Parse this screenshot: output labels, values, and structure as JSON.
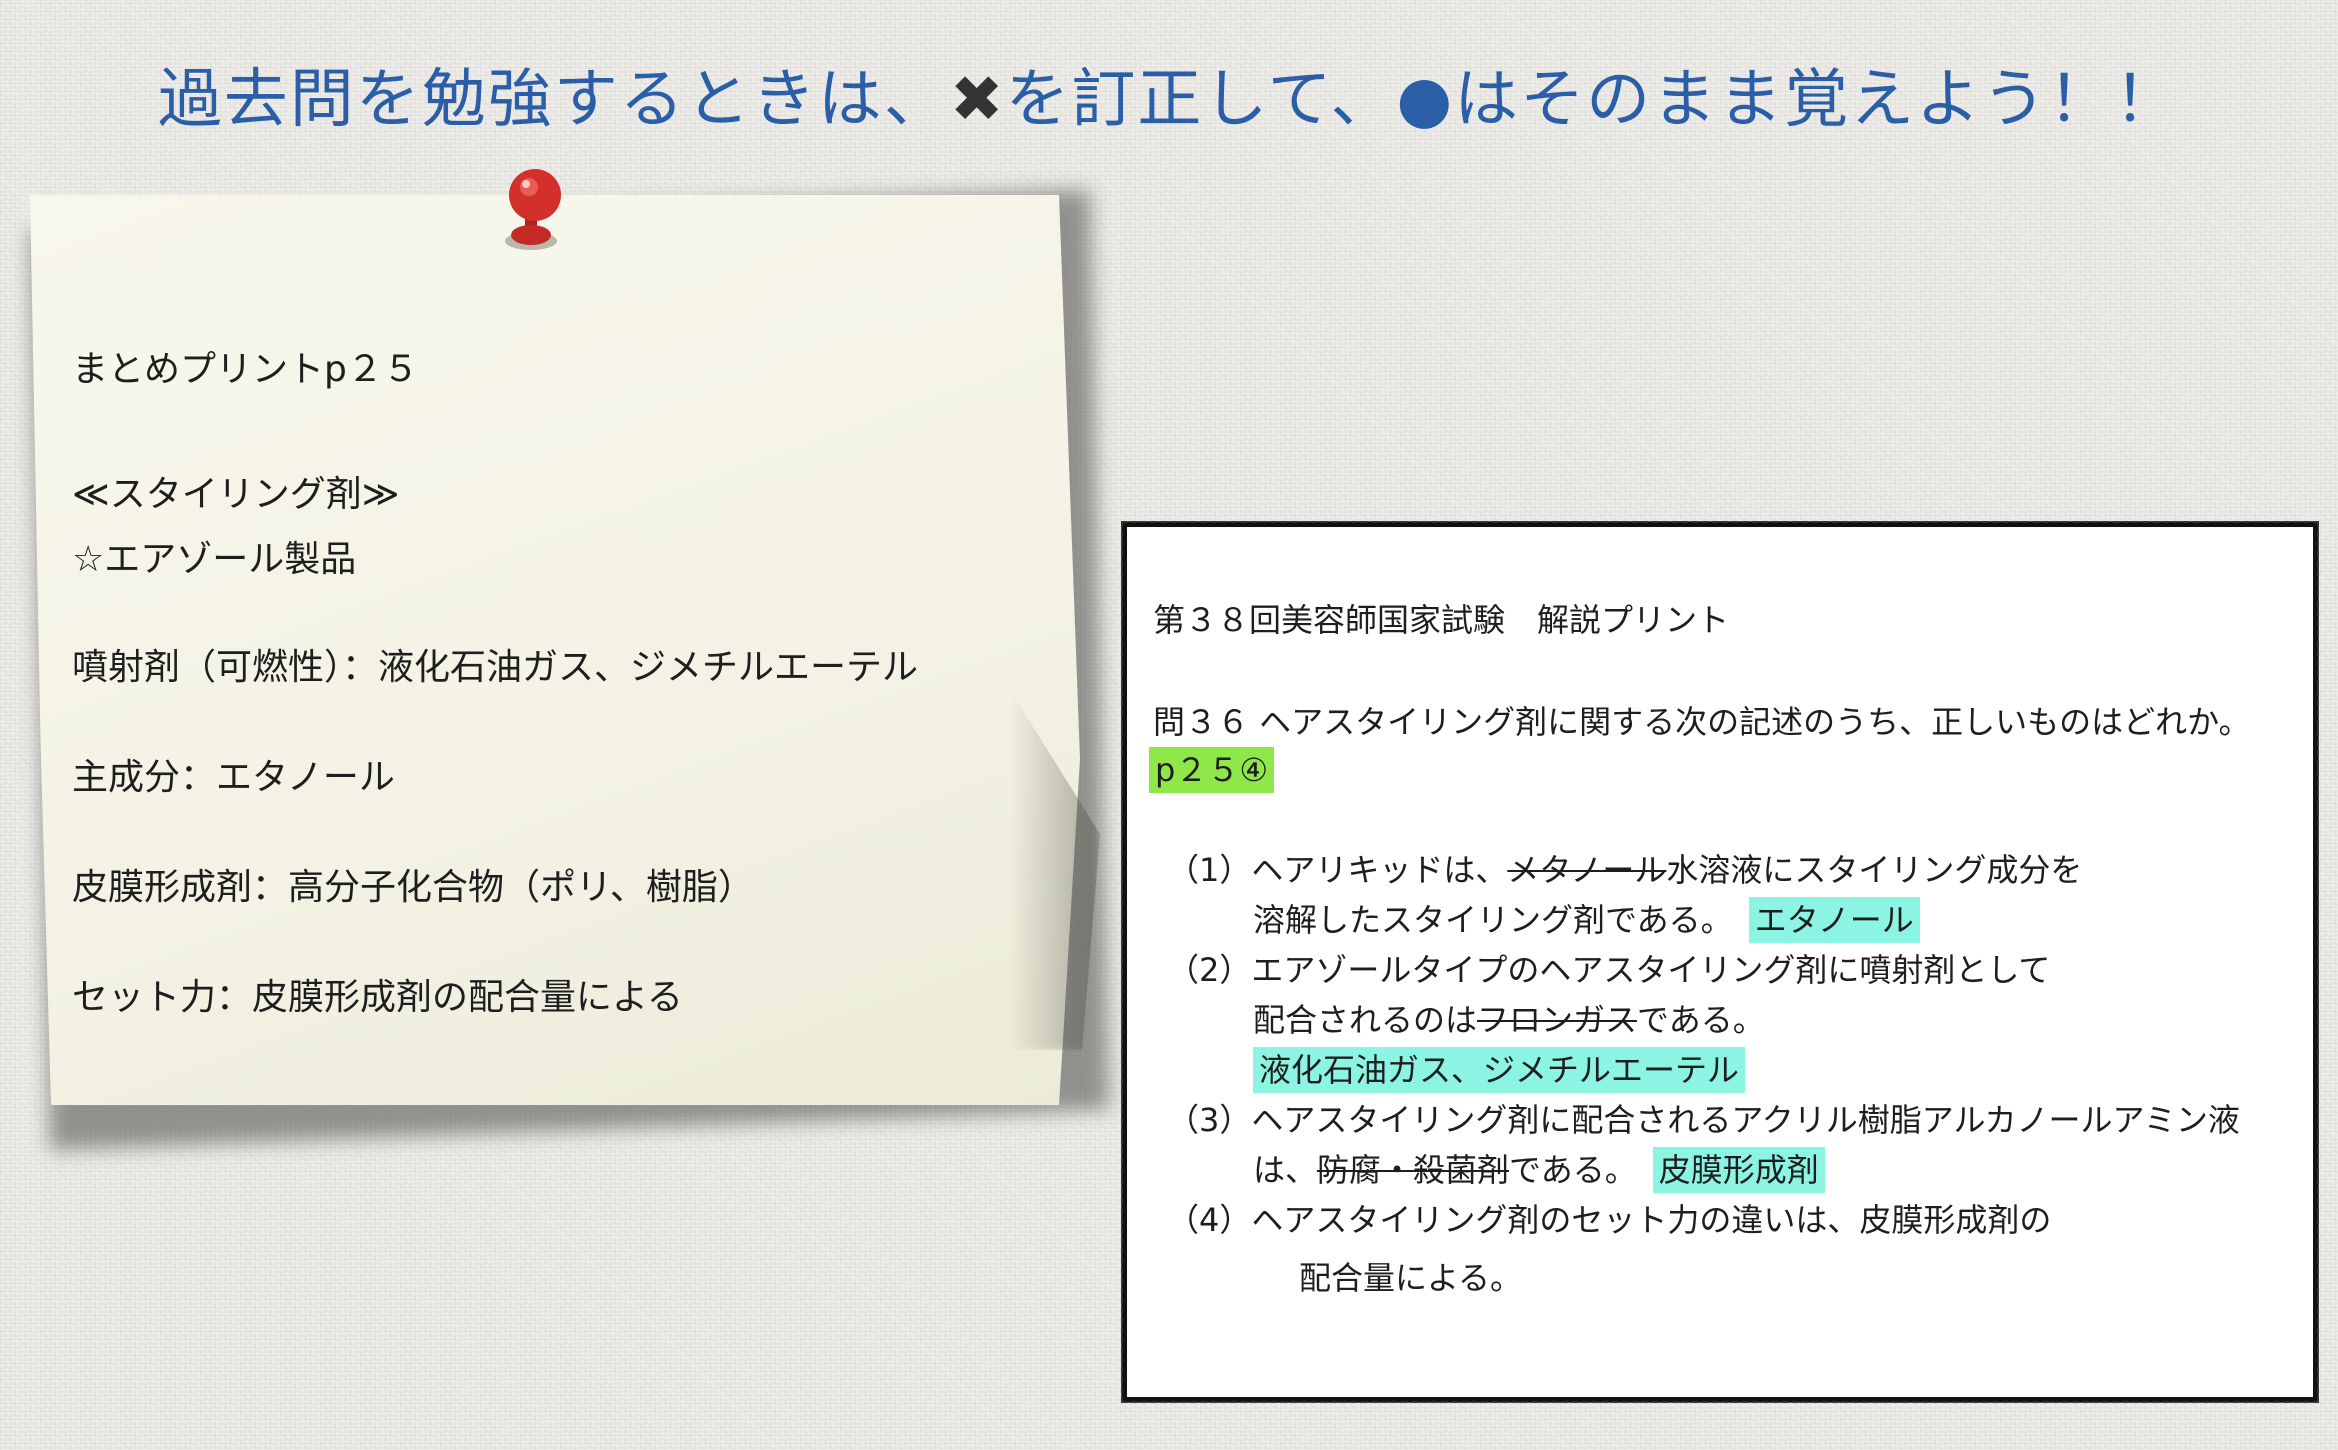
{
  "header": {
    "title_part1": "過去問を勉強するときは、",
    "x_mark": "✖",
    "title_part2": "を訂正して、",
    "dot_mark": "●",
    "title_part3": "はそのまま覚えよう！！"
  },
  "note": {
    "heading": "まとめプリントp２５",
    "category": "≪スタイリング剤≫",
    "product": "☆エアゾール製品",
    "line1": "噴射剤（可燃性）：液化石油ガス、ジメチルエーテル",
    "line2": "主成分：エタノール",
    "line3": "皮膜形成剤：高分子化合物（ポリ、樹脂）",
    "line4": "セット力：皮膜形成剤の配合量による"
  },
  "answer": {
    "heading": "第３８回美容師国家試験　解説プリント",
    "question": "問３６ ヘアスタイリング剤に関する次の記述のうち、正しいものはどれか。",
    "reference": "p２５④",
    "item1": {
      "prefix": "（1）ヘアリキッドは、",
      "struck": "メタノール",
      "suffix": "水溶液にスタイリング成分を",
      "cont": "溶解したスタイリング剤である。",
      "correction": "エタノール"
    },
    "item2": {
      "line1": "（2）エアゾールタイプのヘアスタイリング剤に噴射剤として",
      "prefix": "配合されるのは",
      "struck": "フロンガス",
      "suffix": "である。",
      "correction": "液化石油ガス、ジメチルエーテル"
    },
    "item3": {
      "line1": "（3）ヘアスタイリング剤に配合されるアクリル樹脂アルカノールアミン液",
      "prefix": "は、",
      "struck": "防腐・殺菌剤",
      "suffix": "である。",
      "correction": "皮膜形成剤"
    },
    "item4": {
      "line1": "（4）ヘアスタイリング剤のセット力の違いは、皮膜形成剤の",
      "line2": "配合量による。"
    }
  },
  "colors": {
    "title": "#2a5ea6",
    "highlight_green": "#8fe84a",
    "highlight_cyan": "#8cf4e2",
    "note_paper": "#f5f4e8",
    "pin": "#d3302c"
  }
}
